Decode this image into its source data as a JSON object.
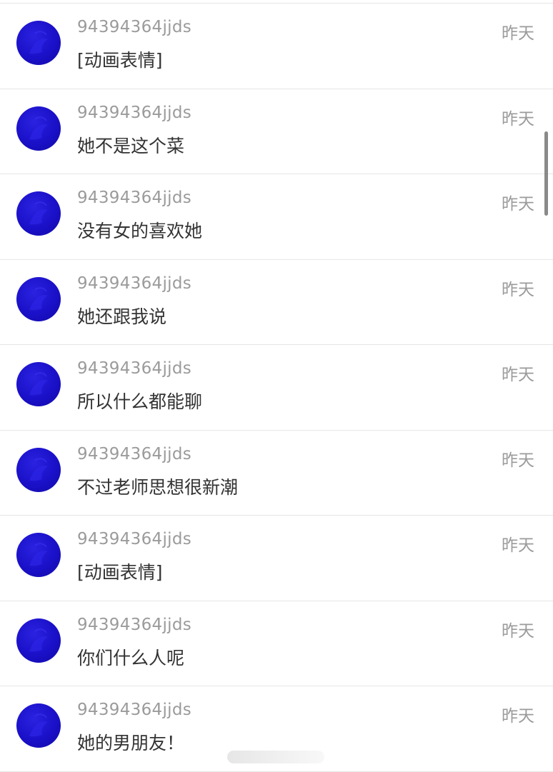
{
  "messages": [
    {
      "username": "94394364jjds",
      "text": "[动画表情]",
      "time": "昨天"
    },
    {
      "username": "94394364jjds",
      "text": "她不是这个菜",
      "time": "昨天"
    },
    {
      "username": "94394364jjds",
      "text": "没有女的喜欢她",
      "time": "昨天"
    },
    {
      "username": "94394364jjds",
      "text": "她还跟我说",
      "time": "昨天"
    },
    {
      "username": "94394364jjds",
      "text": "所以什么都能聊",
      "time": "昨天"
    },
    {
      "username": "94394364jjds",
      "text": "不过老师思想很新潮",
      "time": "昨天"
    },
    {
      "username": "94394364jjds",
      "text": "[动画表情]",
      "time": "昨天"
    },
    {
      "username": "94394364jjds",
      "text": "你们什么人呢",
      "time": "昨天"
    },
    {
      "username": "94394364jjds",
      "text": "她的男朋友！",
      "time": "昨天"
    }
  ],
  "colors": {
    "avatar": "#1a10c8",
    "username": "#9b9b9b",
    "message": "#333333",
    "divider": "#e6e6e6"
  },
  "icons": {
    "avatar": "avatar-icon"
  }
}
